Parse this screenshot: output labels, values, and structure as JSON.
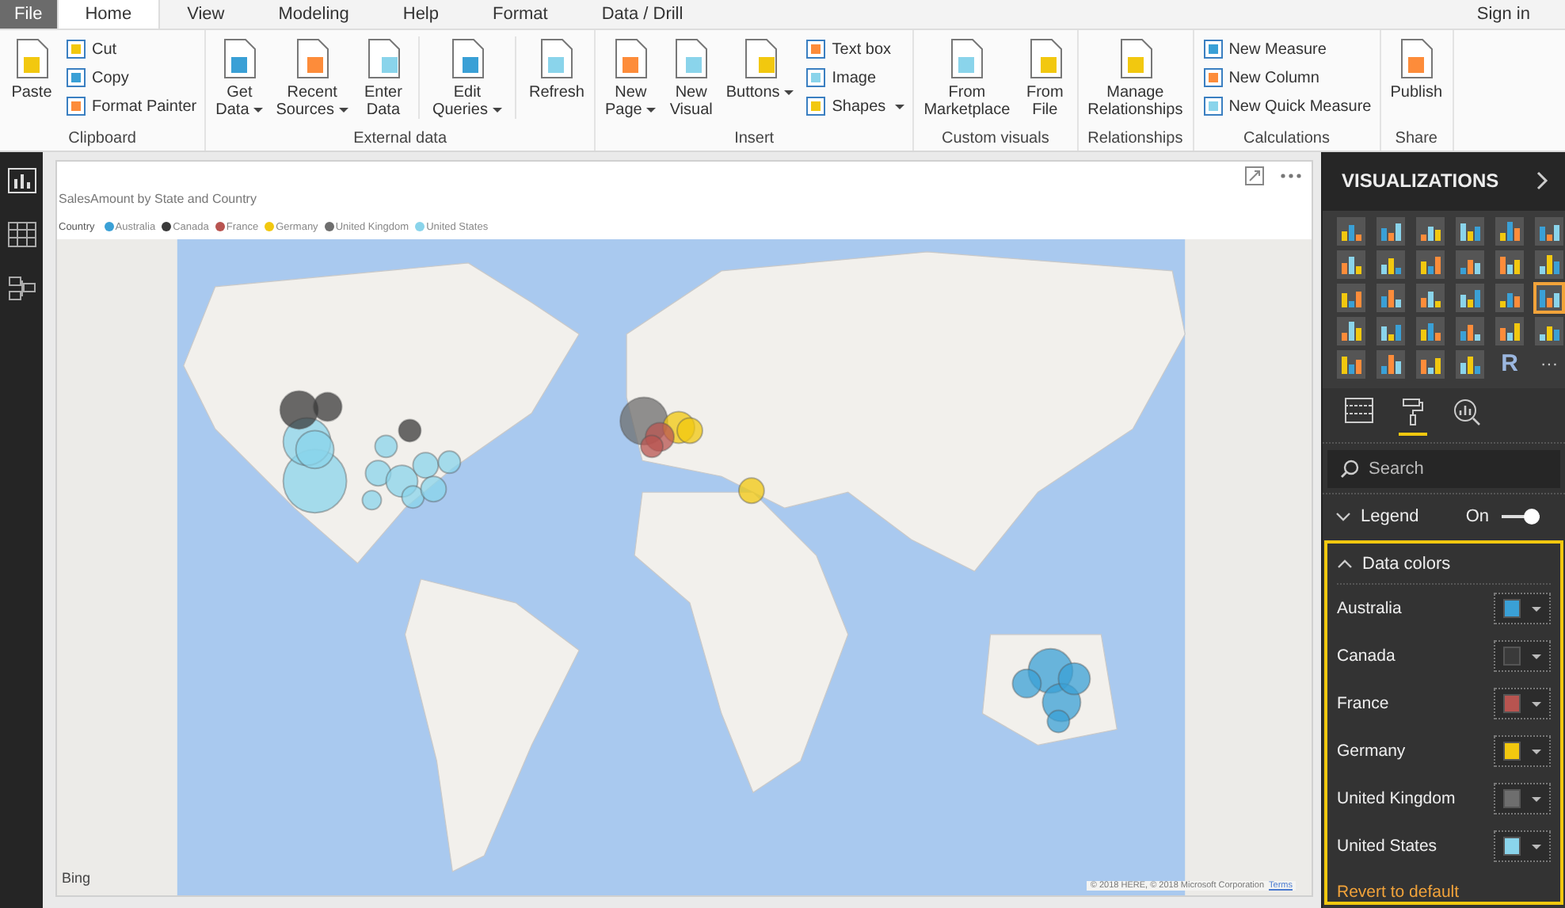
{
  "menu_tabs": [
    {
      "label": "File",
      "kind": "file",
      "selected": false
    },
    {
      "label": "Home",
      "kind": "tab",
      "selected": true
    },
    {
      "label": "View",
      "kind": "tab",
      "selected": false
    },
    {
      "label": "Modeling",
      "kind": "tab",
      "selected": false
    },
    {
      "label": "Help",
      "kind": "tab",
      "selected": false
    },
    {
      "label": "Format",
      "kind": "tab",
      "selected": false
    },
    {
      "label": "Data / Drill",
      "kind": "tab",
      "selected": false
    }
  ],
  "sign_in": "Sign in",
  "ribbon": [
    {
      "label": "Clipboard",
      "items": [
        {
          "kind": "large",
          "lines": [
            "Paste"
          ],
          "dropdown": false
        },
        {
          "kind": "stack",
          "items": [
            {
              "label": "Cut",
              "dropdown": false
            },
            {
              "label": "Copy",
              "dropdown": false
            },
            {
              "label": "Format Painter",
              "dropdown": false
            }
          ]
        }
      ]
    },
    {
      "label": "External data",
      "items": [
        {
          "kind": "large",
          "lines": [
            "Get",
            "Data"
          ],
          "dropdown": true
        },
        {
          "kind": "large",
          "lines": [
            "Recent",
            "Sources"
          ],
          "dropdown": true
        },
        {
          "kind": "large",
          "lines": [
            "Enter",
            "Data"
          ],
          "dropdown": false
        },
        {
          "kind": "separator"
        },
        {
          "kind": "large",
          "lines": [
            "Edit",
            "Queries"
          ],
          "dropdown": true
        },
        {
          "kind": "separator"
        },
        {
          "kind": "large",
          "lines": [
            "Refresh"
          ],
          "dropdown": false
        }
      ]
    },
    {
      "label": "Insert",
      "items": [
        {
          "kind": "large",
          "lines": [
            "New",
            "Page"
          ],
          "dropdown": true
        },
        {
          "kind": "large",
          "lines": [
            "New",
            "Visual"
          ],
          "dropdown": false
        },
        {
          "kind": "large",
          "lines": [
            "Buttons"
          ],
          "dropdown": true
        },
        {
          "kind": "stack",
          "items": [
            {
              "label": "Text box",
              "dropdown": false
            },
            {
              "label": "Image",
              "dropdown": false
            },
            {
              "label": "Shapes",
              "dropdown": true
            }
          ]
        }
      ]
    },
    {
      "label": "Custom visuals",
      "items": [
        {
          "kind": "large",
          "lines": [
            "From",
            "Marketplace"
          ],
          "dropdown": false
        },
        {
          "kind": "large",
          "lines": [
            "From",
            "File"
          ],
          "dropdown": false
        }
      ]
    },
    {
      "label": "Relationships",
      "items": [
        {
          "kind": "large",
          "lines": [
            "Manage",
            "Relationships"
          ],
          "dropdown": false
        }
      ]
    },
    {
      "label": "Calculations",
      "items": [
        {
          "kind": "stack",
          "items": [
            {
              "label": "New Measure",
              "dropdown": false
            },
            {
              "label": "New Column",
              "dropdown": false
            },
            {
              "label": "New Quick Measure",
              "dropdown": false
            }
          ]
        }
      ]
    },
    {
      "label": "Share",
      "items": [
        {
          "kind": "large",
          "lines": [
            "Publish"
          ],
          "dropdown": false
        }
      ]
    }
  ],
  "visual": {
    "title": "SalesAmount by State and Country",
    "legend": {
      "title": "Country",
      "items": [
        {
          "label": "Australia",
          "color": "#3aa0d6"
        },
        {
          "label": "Canada",
          "color": "#3a3a3a"
        },
        {
          "label": "France",
          "color": "#b85450"
        },
        {
          "label": "Germany",
          "color": "#f2c80f"
        },
        {
          "label": "United Kingdom",
          "color": "#6e6e6e"
        },
        {
          "label": "United States",
          "color": "#8ad4eb"
        }
      ]
    },
    "map": {
      "logo": "Bing",
      "attribution": "© 2018 HERE, © 2018 Microsoft Corporation",
      "terms_link": "Terms"
    }
  },
  "visualizations_pane": {
    "title": "VISUALIZATIONS",
    "visual_types": [
      {
        "selected": false
      },
      {
        "selected": false
      },
      {
        "selected": false
      },
      {
        "selected": false
      },
      {
        "selected": false
      },
      {
        "selected": false
      },
      {
        "selected": false
      },
      {
        "selected": false
      },
      {
        "selected": false
      },
      {
        "selected": false
      },
      {
        "selected": false
      },
      {
        "selected": false
      },
      {
        "selected": false
      },
      {
        "selected": false
      },
      {
        "selected": false
      },
      {
        "selected": false
      },
      {
        "selected": false
      },
      {
        "selected": true
      },
      {
        "selected": false
      },
      {
        "selected": false
      },
      {
        "selected": false
      },
      {
        "selected": false
      },
      {
        "selected": false
      },
      {
        "selected": false
      },
      {
        "selected": false
      },
      {
        "selected": false
      },
      {
        "selected": false
      },
      {
        "selected": false
      }
    ],
    "r_visual": "R",
    "more": "···",
    "pane_tabs": [
      {
        "kind": "fields",
        "selected": false
      },
      {
        "kind": "format",
        "selected": true
      },
      {
        "kind": "analytics",
        "selected": false
      }
    ],
    "search": {
      "placeholder": "Search"
    },
    "legend_section": {
      "label": "Legend",
      "expanded": false,
      "toggle_label": "On",
      "on": true
    },
    "data_colors": {
      "label": "Data colors",
      "expanded": true,
      "items": [
        {
          "name": "Australia",
          "color": "#3aa0d6"
        },
        {
          "name": "Canada",
          "color": "#3a3a3a"
        },
        {
          "name": "France",
          "color": "#b85450"
        },
        {
          "name": "Germany",
          "color": "#f2c80f"
        },
        {
          "name": "United Kingdom",
          "color": "#6e6e6e"
        },
        {
          "name": "United States",
          "color": "#8ad4eb"
        }
      ],
      "revert_link": "Revert to default"
    }
  }
}
